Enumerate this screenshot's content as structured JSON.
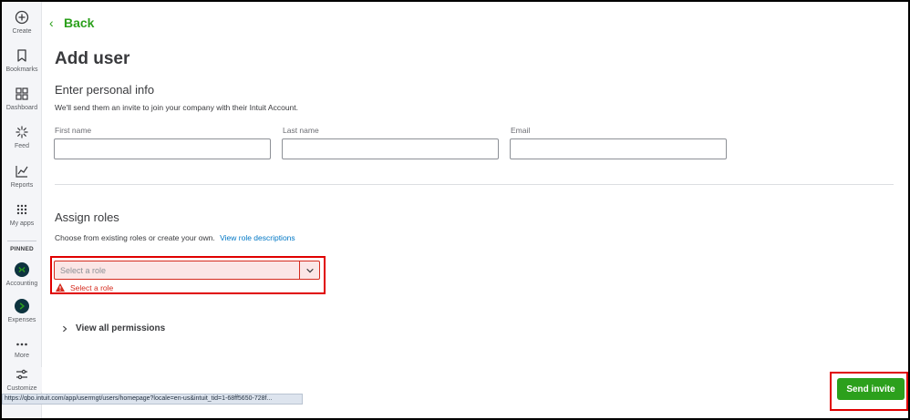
{
  "sidebar": {
    "items": [
      {
        "label": "Create",
        "icon": "plus-circle-icon"
      },
      {
        "label": "Bookmarks",
        "icon": "bookmark-icon"
      },
      {
        "label": "Dashboard",
        "icon": "dashboard-icon"
      },
      {
        "label": "Feed",
        "icon": "feed-icon"
      },
      {
        "label": "Reports",
        "icon": "reports-icon"
      },
      {
        "label": "My apps",
        "icon": "apps-grid-icon"
      }
    ],
    "pinned_label": "PINNED",
    "pinned": [
      {
        "label": "Accounting",
        "icon": "accounting-icon"
      },
      {
        "label": "Expenses",
        "icon": "expenses-icon"
      }
    ],
    "more_label": "More",
    "customize_label": "Customize"
  },
  "header": {
    "back_label": "Back",
    "title": "Add user"
  },
  "personal_info": {
    "heading": "Enter personal info",
    "description": "We'll send them an invite to join your company with their Intuit Account.",
    "first_name_label": "First name",
    "first_name_value": "",
    "last_name_label": "Last name",
    "last_name_value": "",
    "email_label": "Email",
    "email_value": ""
  },
  "roles": {
    "heading": "Assign roles",
    "description": "Choose from existing roles or create your own.",
    "link": "View role descriptions",
    "select_placeholder": "Select a role",
    "error_message": "Select a role"
  },
  "permissions": {
    "label": "View all permissions"
  },
  "status_bar": {
    "url": "https://qbo.intuit.com/app/usermgt/users/homepage?locale=en-us&intuit_tid=1-68ff5650-728f..."
  },
  "actions": {
    "send_invite": "Send invite"
  },
  "colors": {
    "accent": "#2ca01c",
    "error": "#d52b1e",
    "highlight": "#e00000",
    "link": "#0077c5"
  }
}
